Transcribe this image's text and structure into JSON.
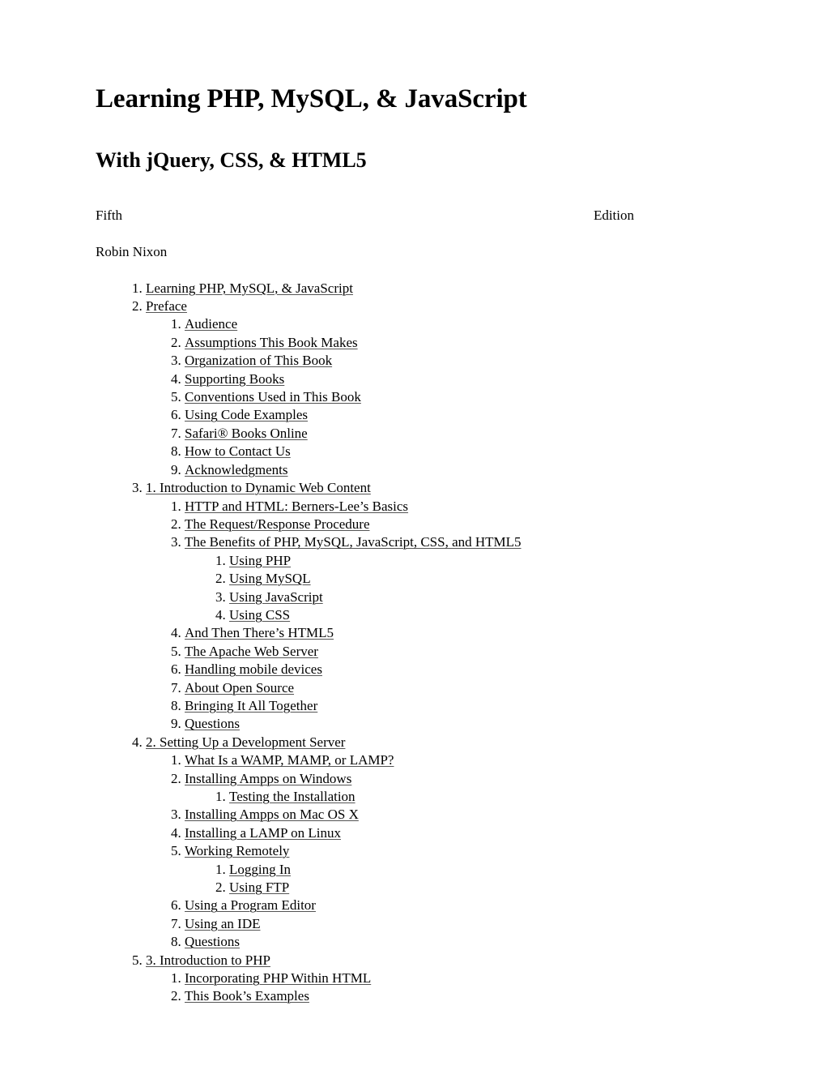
{
  "document": {
    "title": "Learning PHP, MySQL, & JavaScript",
    "subtitle": "With jQuery, CSS, & HTML5",
    "edition_ordinal": "Fifth",
    "edition_word": "Edition",
    "author": "Robin Nixon"
  },
  "toc": [
    {
      "label": "Learning PHP, MySQL, & JavaScript",
      "children": []
    },
    {
      "label": "Preface",
      "children": [
        {
          "label": "Audience",
          "children": []
        },
        {
          "label": "Assumptions This Book Makes",
          "children": []
        },
        {
          "label": "Organization of This Book",
          "children": []
        },
        {
          "label": "Supporting Books",
          "children": []
        },
        {
          "label": "Conventions Used in This Book",
          "children": []
        },
        {
          "label": "Using Code Examples",
          "children": []
        },
        {
          "label": "Safari® Books Online",
          "children": []
        },
        {
          "label": "How to Contact Us",
          "children": []
        },
        {
          "label": "Acknowledgments",
          "children": []
        }
      ]
    },
    {
      "label": "1. Introduction to Dynamic Web Content",
      "children": [
        {
          "label": "HTTP and HTML: Berners-Lee’s Basics",
          "children": []
        },
        {
          "label": "The Request/Response Procedure",
          "children": []
        },
        {
          "label": "The Benefits of PHP, MySQL, JavaScript, CSS, and HTML5",
          "children": [
            {
              "label": "Using PHP",
              "children": []
            },
            {
              "label": "Using MySQL",
              "children": []
            },
            {
              "label": "Using JavaScript",
              "children": []
            },
            {
              "label": "Using CSS",
              "children": []
            }
          ]
        },
        {
          "label": "And Then There’s HTML5",
          "children": []
        },
        {
          "label": "The Apache Web Server",
          "children": []
        },
        {
          "label": "Handling mobile devices",
          "children": []
        },
        {
          "label": "About Open Source",
          "children": []
        },
        {
          "label": "Bringing It All Together",
          "children": []
        },
        {
          "label": "Questions",
          "children": []
        }
      ]
    },
    {
      "label": "2. Setting Up a Development Server",
      "children": [
        {
          "label": "What Is a WAMP, MAMP, or LAMP?",
          "children": []
        },
        {
          "label": "Installing Ampps on Windows",
          "children": [
            {
              "label": "Testing the Installation",
              "children": []
            }
          ]
        },
        {
          "label": "Installing Ampps on Mac OS X",
          "children": []
        },
        {
          "label": "Installing a LAMP on Linux",
          "children": []
        },
        {
          "label": "Working Remotely",
          "children": [
            {
              "label": "Logging In",
              "children": []
            },
            {
              "label": "Using FTP",
              "children": []
            }
          ]
        },
        {
          "label": "Using a Program Editor",
          "children": []
        },
        {
          "label": "Using an IDE",
          "children": []
        },
        {
          "label": "Questions",
          "children": []
        }
      ]
    },
    {
      "label": "3. Introduction to PHP",
      "children": [
        {
          "label": "Incorporating PHP Within HTML",
          "children": []
        },
        {
          "label": "This Book’s Examples",
          "children": []
        }
      ]
    }
  ]
}
